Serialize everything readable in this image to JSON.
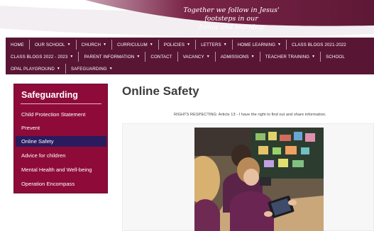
{
  "header": {
    "motto_lines": [
      "Together we follow in Jesus'",
      "footsteps in our",
      "living and learning"
    ]
  },
  "nav": {
    "row1": [
      {
        "label": "HOME",
        "dropdown": false
      },
      {
        "label": "OUR SCHOOL",
        "dropdown": true
      },
      {
        "label": "CHURCH",
        "dropdown": true
      },
      {
        "label": "CURRICULUM",
        "dropdown": true
      },
      {
        "label": "POLICIES",
        "dropdown": true
      },
      {
        "label": "LETTERS",
        "dropdown": true
      },
      {
        "label": "HOME LEARNING",
        "dropdown": true
      },
      {
        "label": "CLASS BLOGS 2021-2022",
        "dropdown": false
      }
    ],
    "row2": [
      {
        "label": "CLASS BLOGS 2022 - 2023",
        "dropdown": true
      },
      {
        "label": "PARENT INFORMATION",
        "dropdown": true
      },
      {
        "label": "CONTACT",
        "dropdown": false
      },
      {
        "label": "VACANCY",
        "dropdown": true
      },
      {
        "label": "ADMISSIONS",
        "dropdown": true
      },
      {
        "label": "TEACHER TRAINING",
        "dropdown": true
      },
      {
        "label": "SCHOOL",
        "dropdown": false
      }
    ],
    "row3": [
      {
        "label": "OPAL PLAYGROUND",
        "dropdown": true
      },
      {
        "label": "SAFEGUARDING",
        "dropdown": true
      }
    ]
  },
  "sidebar": {
    "title": "Safeguarding",
    "items": [
      {
        "label": "Child Protection Statement",
        "active": false
      },
      {
        "label": "Prevent",
        "active": false
      },
      {
        "label": "Online Safety",
        "active": true
      },
      {
        "label": "Advice for children",
        "active": false
      },
      {
        "label": "Mental Health and Well-being",
        "active": false
      },
      {
        "label": "Operation Encompass",
        "active": false
      }
    ]
  },
  "main": {
    "title": "Online Safety",
    "intro": "RIGHTS RESPECTING: Article 13 - I have the right to find out and share information."
  },
  "colors": {
    "nav_bg": "#591534",
    "sidebar_bg": "#8e0b39",
    "sidebar_active": "#2a1b5e",
    "banner_wave": "#6a1a3e"
  }
}
